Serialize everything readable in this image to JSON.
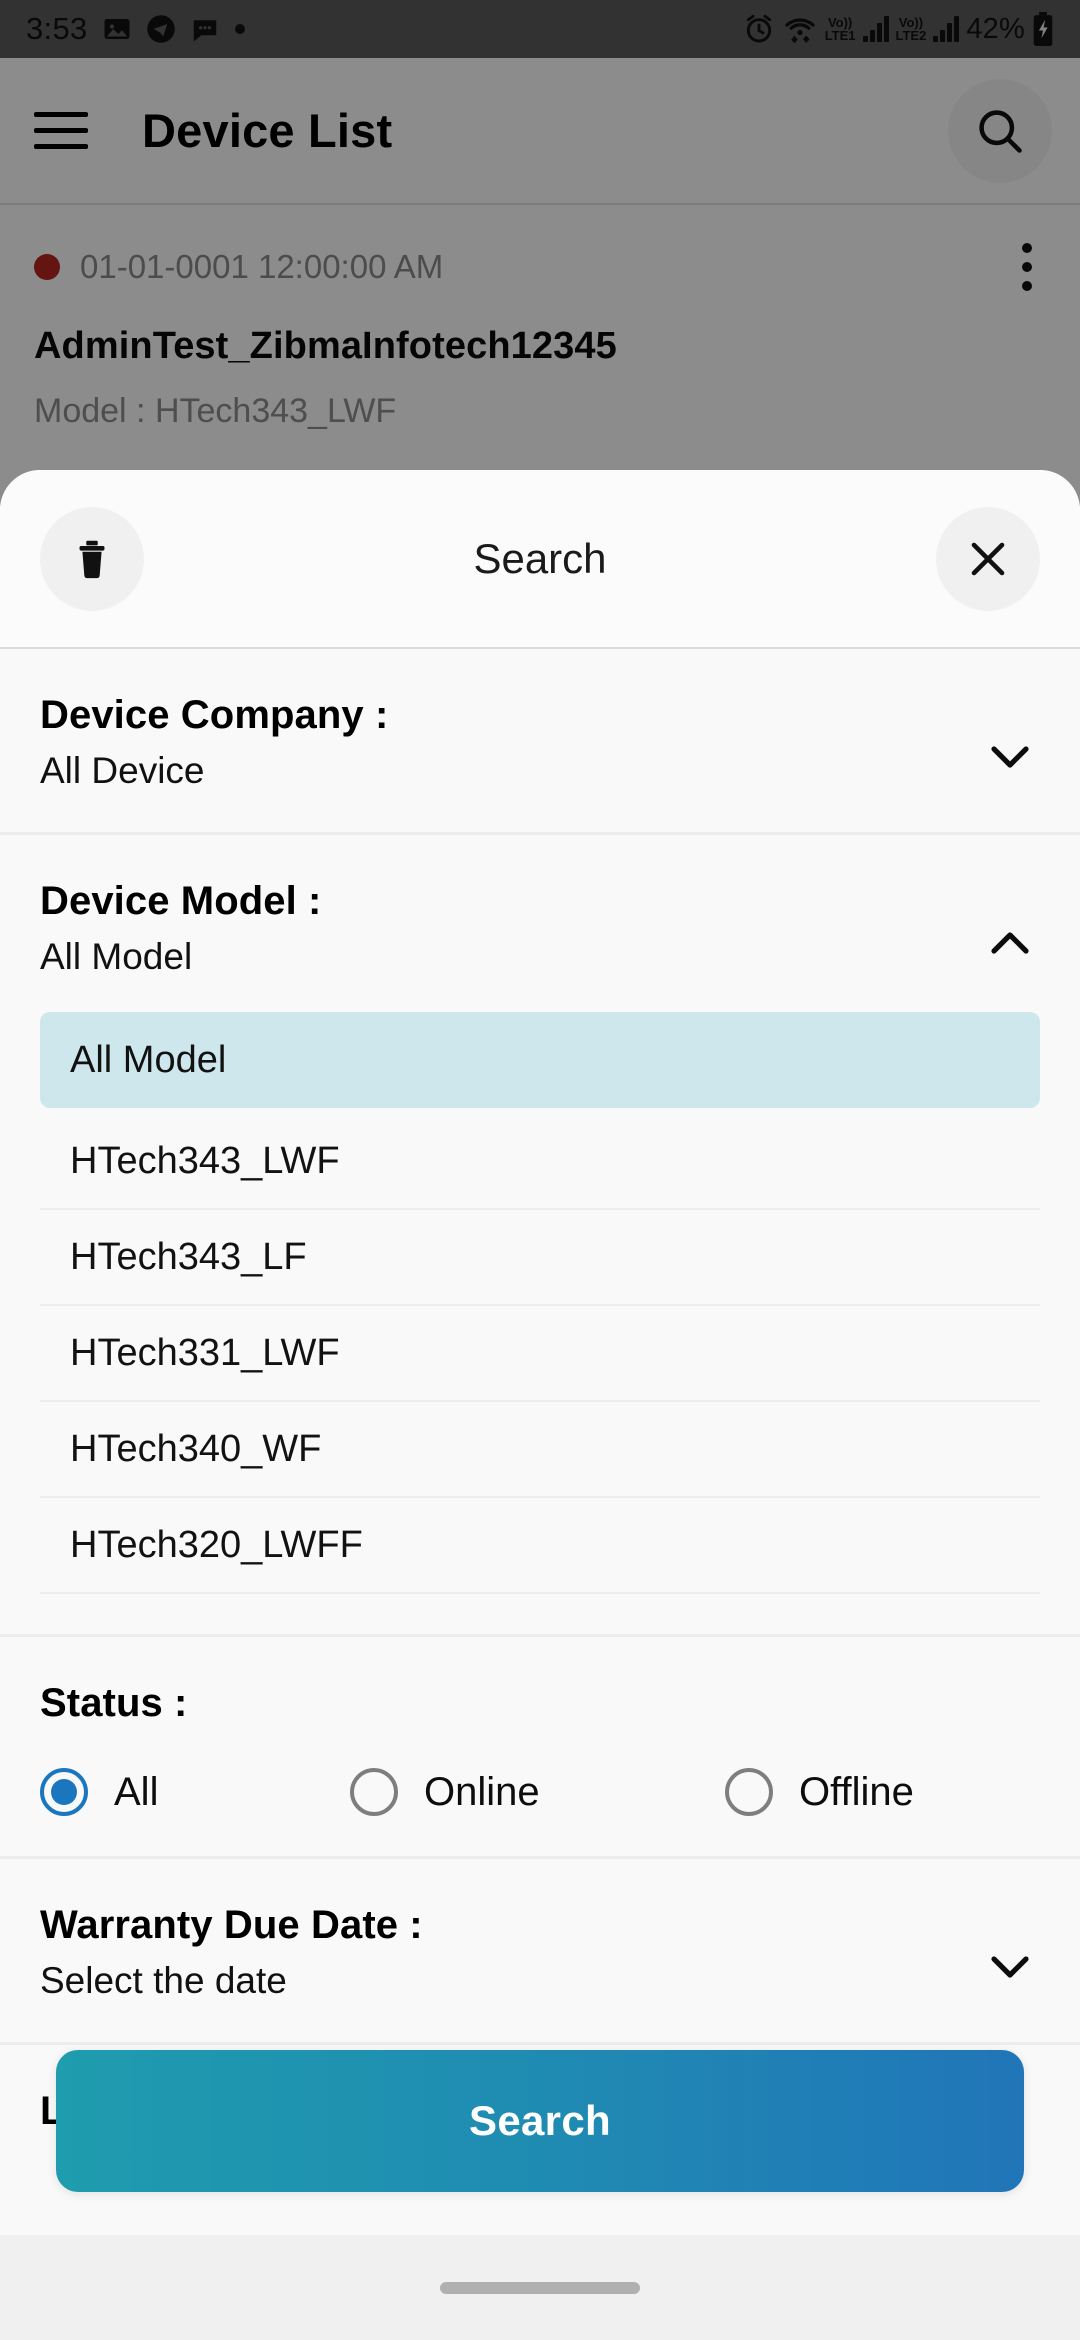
{
  "status_bar": {
    "time": "3:53",
    "battery": "42%",
    "network_1": {
      "voice": "Vo))",
      "tech": "LTE1"
    },
    "network_2": {
      "voice": "Vo))",
      "tech": "LTE2"
    },
    "icons": [
      "image-icon",
      "telegram-icon",
      "chat-bubble-icon",
      "dot-icon",
      "alarm-icon",
      "wifi-icon",
      "battery-charging-icon"
    ]
  },
  "app_bar": {
    "title": "Device List",
    "menu_icon": "hamburger-menu-icon",
    "search_icon": "search-icon"
  },
  "device_list": {
    "items": [
      {
        "status_dot_color": "#b7261f",
        "timestamp": "01-01-0001 12:00:00 AM",
        "name": "AdminTest_ZibmaInfotech12345",
        "model": "Model : HTech343_LWF",
        "overflow_icon": "three-dot-menu-icon"
      }
    ]
  },
  "sheet": {
    "title": "Search",
    "delete_icon": "trash-icon",
    "close_icon": "close-x-icon",
    "sections": {
      "device_company": {
        "label": "Device Company :",
        "value": "All Device",
        "chevron": "chevron-down-icon",
        "expanded": false
      },
      "device_model": {
        "label": "Device Model :",
        "value": "All Model",
        "chevron": "chevron-up-icon",
        "expanded": true,
        "options": [
          "All Model",
          "HTech343_LWF",
          "HTech343_LF",
          "HTech331_LWF",
          "HTech340_WF",
          "HTech320_LWFF"
        ],
        "selected_option": "All Model",
        "selected_bg": "#cde7ec"
      },
      "status": {
        "label": "Status :",
        "options": [
          "All",
          "Online",
          "Offline"
        ],
        "selected": "All",
        "accent": "#1976bf"
      },
      "warranty_due_date": {
        "label": "Warranty Due Date :",
        "value": "Select the date",
        "chevron": "chevron-down-icon",
        "expanded": false
      },
      "last_connection_time": {
        "label": "Last Connection Time :"
      }
    },
    "submit_button": {
      "label": "Search",
      "gradient_from": "#1f9cae",
      "gradient_to": "#2175b8"
    }
  },
  "nav_bar": {
    "home_indicator": "home-indicator-pill"
  }
}
